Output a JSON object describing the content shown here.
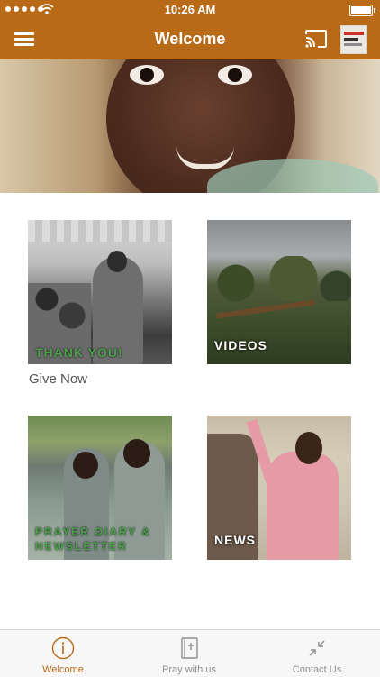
{
  "status_bar": {
    "time": "10:26 AM"
  },
  "header": {
    "title": "Welcome"
  },
  "tiles": [
    {
      "label": "THANK YOU!"
    },
    {
      "label": "VIDEOS"
    },
    {
      "label": "PRAYER DIARY & NEWSLETTER"
    },
    {
      "label": "NEWS"
    }
  ],
  "give_now": "Give Now",
  "tab_bar": [
    {
      "label": "Welcome",
      "icon": "info-icon",
      "active": true
    },
    {
      "label": "Pray with us",
      "icon": "bible-icon",
      "active": false
    },
    {
      "label": "Contact Us",
      "icon": "collapse-arrows-icon",
      "active": false
    }
  ],
  "colors": {
    "brand": "#b86a17",
    "tab_inactive": "#8e8e93",
    "tile_label_green": "#4ca24a"
  }
}
